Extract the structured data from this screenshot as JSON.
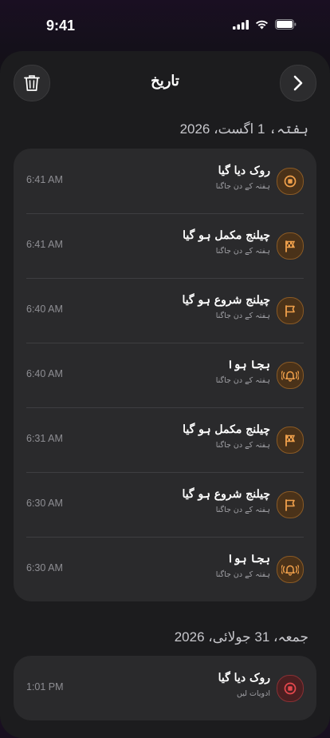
{
  "status": {
    "time": "9:41"
  },
  "header": {
    "title": "تاریخ"
  },
  "colors": {
    "accent_orange": "#f0a04b",
    "accent_red": "#e5484d"
  },
  "sections": [
    {
      "date": "ہفتہ، 1 اگست، 2026",
      "rows": [
        {
          "time": "6:41 AM",
          "title": "روک دیا گیا",
          "subtitle": "ہفتہ کے دن جاگنا",
          "icon": "stop-icon",
          "color": "orange"
        },
        {
          "time": "6:41 AM",
          "title": "چیلنج مکمل ہو گیا",
          "subtitle": "ہفتہ کے دن جاگنا",
          "icon": "checkered-flag-icon",
          "color": "orange"
        },
        {
          "time": "6:40 AM",
          "title": "چیلنج شروع ہو گیا",
          "subtitle": "ہفتہ کے دن جاگنا",
          "icon": "flag-icon",
          "color": "orange"
        },
        {
          "time": "6:40 AM",
          "title": "بجا ہوا",
          "subtitle": "ہفتہ کے دن جاگنا",
          "icon": "ringing-bell-icon",
          "color": "orange"
        },
        {
          "time": "6:31 AM",
          "title": "چیلنج مکمل ہو گیا",
          "subtitle": "ہفتہ کے دن جاگنا",
          "icon": "checkered-flag-icon",
          "color": "orange"
        },
        {
          "time": "6:30 AM",
          "title": "چیلنج شروع ہو گیا",
          "subtitle": "ہفتہ کے دن جاگنا",
          "icon": "flag-icon",
          "color": "orange"
        },
        {
          "time": "6:30 AM",
          "title": "بجا ہوا",
          "subtitle": "ہفتہ کے دن جاگنا",
          "icon": "ringing-bell-icon",
          "color": "orange"
        }
      ]
    },
    {
      "date": "جمعہ، 31 جولائی، 2026",
      "rows": [
        {
          "time": "1:01 PM",
          "title": "روک دیا گیا",
          "subtitle": "ادویات لیں",
          "icon": "stop-icon",
          "color": "red"
        }
      ]
    }
  ]
}
